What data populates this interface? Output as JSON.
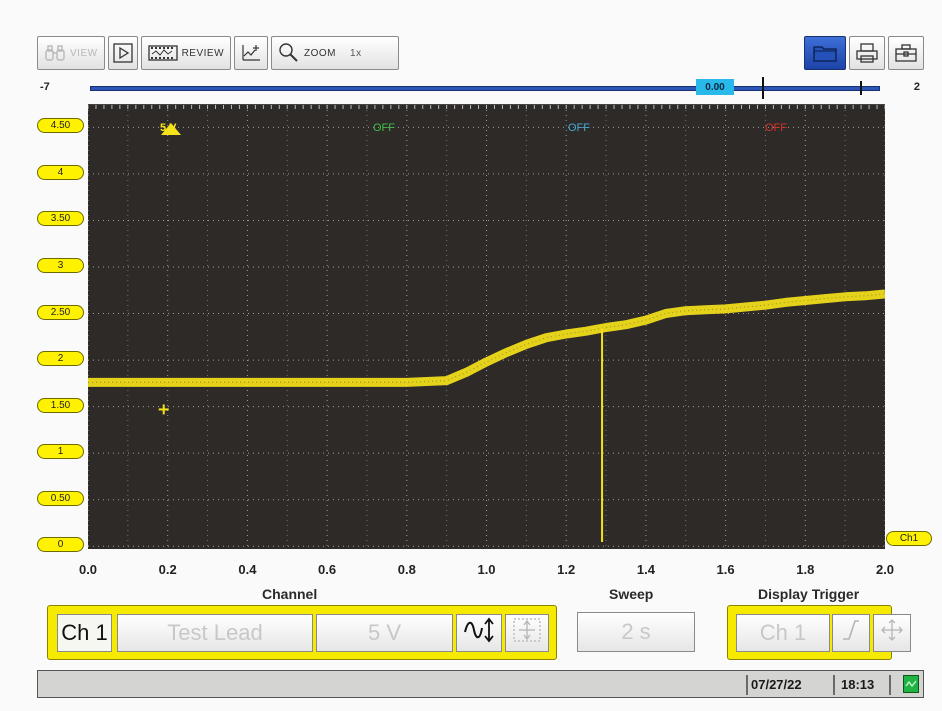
{
  "toolbar": {
    "view_label": "VIEW",
    "review_label": "REVIEW",
    "zoom_label": "ZOOM",
    "zoom_value": "1x"
  },
  "timeline": {
    "left_value": "-7",
    "right_value": "2",
    "current_value": "0.00"
  },
  "channels": [
    {
      "label": "5 V",
      "color": "#f5e21a",
      "icon": "triangle-icon"
    },
    {
      "label": "OFF",
      "color": "#3fbf4a"
    },
    {
      "label": "OFF",
      "color": "#46a8d8"
    },
    {
      "label": "OFF",
      "color": "#d8322b"
    }
  ],
  "chart_data": {
    "type": "line",
    "xlabel": "",
    "ylabel": "",
    "x_ticks": [
      "0.0",
      "0.2",
      "0.4",
      "0.6",
      "0.8",
      "1.0",
      "1.2",
      "1.4",
      "1.6",
      "1.8",
      "2.0"
    ],
    "y_ticks": [
      "4.50",
      "4",
      "3.50",
      "3",
      "2.50",
      "2",
      "1.50",
      "1",
      "0.50",
      "0"
    ],
    "xlim": [
      0,
      2.0
    ],
    "ylim": [
      -0.04,
      4.74
    ],
    "grid": true,
    "series": [
      {
        "name": "Ch1",
        "color": "#f5e21a",
        "x": [
          0.0,
          0.1,
          0.2,
          0.3,
          0.4,
          0.5,
          0.6,
          0.7,
          0.8,
          0.85,
          0.9,
          0.95,
          1.0,
          1.05,
          1.1,
          1.15,
          1.2,
          1.25,
          1.3,
          1.35,
          1.4,
          1.45,
          1.5,
          1.55,
          1.6,
          1.65,
          1.7,
          1.75,
          1.8,
          1.85,
          1.9,
          1.95,
          2.0
        ],
        "y": [
          1.76,
          1.76,
          1.76,
          1.76,
          1.76,
          1.76,
          1.76,
          1.76,
          1.76,
          1.77,
          1.78,
          1.87,
          1.98,
          2.08,
          2.17,
          2.24,
          2.28,
          2.31,
          2.35,
          2.38,
          2.43,
          2.5,
          2.53,
          2.54,
          2.55,
          2.57,
          2.59,
          2.62,
          2.64,
          2.66,
          2.68,
          2.69,
          2.71
        ]
      }
    ],
    "cursor_x": 1.29,
    "marker": {
      "x": 0.19,
      "y": 1.47
    }
  },
  "ch1_tag": "Ch1",
  "sections": {
    "channel": "Channel",
    "sweep": "Sweep",
    "display_trigger": "Display Trigger"
  },
  "channel_bar": {
    "channel": "Ch 1",
    "lead": "Test Lead",
    "range": "5 V"
  },
  "sweep_bar": {
    "value": "2 s"
  },
  "trigger_bar": {
    "channel": "Ch 1"
  },
  "status": {
    "date": "07/27/22",
    "time": "18:13"
  }
}
